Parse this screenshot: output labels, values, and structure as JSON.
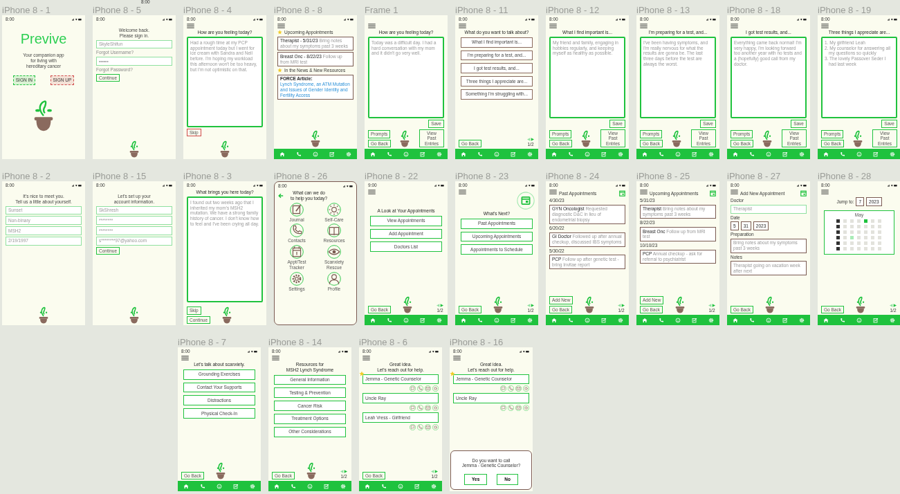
{
  "canvas_label": "8:00",
  "rows": [
    {
      "frames": [
        {
          "title": "iPhone 8 - 1",
          "time": "8:00",
          "menu": false,
          "nav": false,
          "bordered": false,
          "blocks": [
            {
              "kind": "logo",
              "text": "Previve"
            },
            {
              "kind": "para",
              "lines": [
                "Your companion app",
                "for living with",
                "hereditary cancer"
              ]
            },
            {
              "kind": "pair",
              "buttons": [
                {
                  "label": "SIGN IN",
                  "color": "#1fc23e"
                },
                {
                  "label": "SIGN UP",
                  "color": "#d04a4a"
                }
              ]
            },
            {
              "kind": "hero-plant"
            }
          ]
        },
        {
          "title": "iPhone 8 - 5",
          "time": "8:00",
          "menu": false,
          "nav": false,
          "bordered": false,
          "blocks": [
            {
              "kind": "para",
              "lines": [
                "Welcome back.",
                "Please sign in."
              ]
            },
            {
              "kind": "field",
              "value": "SkyleShifun"
            },
            {
              "kind": "link",
              "text": "Forgot Username?"
            },
            {
              "kind": "field",
              "value": "••••••"
            },
            {
              "kind": "link",
              "text": "Forgot Password?"
            },
            {
              "kind": "button",
              "label": "Continue",
              "color": "#1fc23e"
            },
            {
              "kind": "bottom",
              "plant": true
            }
          ]
        },
        {
          "title": "iPhone 8 - 4",
          "time": "8:00",
          "menu": true,
          "nav": false,
          "bordered": false,
          "blocks": [
            {
              "kind": "heading",
              "lines": [
                "How are you feeling today?"
              ]
            },
            {
              "kind": "entry",
              "text": "Had a rough time at my PCP appointment today but I went for ice cream with Sandra and Neil before. I'm hoping my workload this afternoon won't be too heavy, but I'm not optimistic on that."
            },
            {
              "kind": "button",
              "label": "Skip",
              "color": "#d04a4a"
            },
            {
              "kind": "bottom",
              "plant": true
            }
          ]
        },
        {
          "title": "iPhone 8 - 8",
          "time": "8:00",
          "menu": true,
          "nav": true,
          "bordered": false,
          "blocks": [
            {
              "kind": "section",
              "text": "Upcoming Appointments"
            },
            {
              "kind": "card",
              "title": "Therapist - 5/31/23",
              "note": "Bring notes about my symptoms past 3 weeks"
            },
            {
              "kind": "card",
              "title": "Breast Onc - 8/22/23",
              "note": "Follow up from MRI test"
            },
            {
              "kind": "section",
              "text": "In the News & New Resources"
            },
            {
              "kind": "article",
              "label": "FORCE Article:",
              "link": "Lynch Syndrome, an ATM Mutation and Issues of Gender Identity and Fertility Access"
            },
            {
              "kind": "bottom",
              "plant": true
            }
          ]
        },
        {
          "title": "Frame 1",
          "menu": true,
          "nav": true,
          "bordered": false,
          "blocks": [
            {
              "kind": "heading",
              "lines": [
                "How are you feeling today?"
              ]
            },
            {
              "kind": "entry",
              "text": "Today was a difficult day. I had a hard conversation with my mom and it didn't go very well."
            },
            {
              "kind": "bottom",
              "left": [
                "Prompts",
                "Go Back"
              ],
              "right": [
                "Save",
                "View Past Entries"
              ],
              "plant": true
            }
          ]
        },
        {
          "title": "iPhone 8 - 11",
          "time": "8:00",
          "menu": true,
          "nav": true,
          "bordered": false,
          "blocks": [
            {
              "kind": "heading",
              "lines": [
                "What do you want to talk about?"
              ]
            },
            {
              "kind": "option",
              "label": "What I find important is...",
              "color": "#8a6a5e"
            },
            {
              "kind": "option",
              "label": "I'm preparing for a test, and...",
              "color": "#8a6a5e"
            },
            {
              "kind": "option",
              "label": "I got test results, and...",
              "color": "#8a6a5e"
            },
            {
              "kind": "option",
              "label": "Three things I appreciate are...",
              "color": "#8a6a5e"
            },
            {
              "kind": "option",
              "label": "Something I'm struggling with...",
              "color": "#8a6a5e"
            },
            {
              "kind": "bottom",
              "left": [
                "Go Back"
              ],
              "pager": "1/2",
              "plant": false
            }
          ]
        },
        {
          "title": "iPhone 8 - 12",
          "time": "8:00",
          "menu": true,
          "nav": true,
          "bordered": false,
          "blocks": [
            {
              "kind": "heading",
              "lines": [
                "What I find important is..."
              ]
            },
            {
              "kind": "entry",
              "text": "My friend and family, engaging in hobbies regularly, and keeping myself as healthy as possible."
            },
            {
              "kind": "bottom",
              "left": [
                "Prompts",
                "Go Back"
              ],
              "right": [
                "Save",
                "View Past Entries"
              ],
              "plant": true
            }
          ]
        },
        {
          "title": "iPhone 8 - 13",
          "time": "8:00",
          "menu": true,
          "nav": true,
          "bordered": false,
          "blocks": [
            {
              "kind": "heading",
              "lines": [
                "I'm preparing for a test, and..."
              ]
            },
            {
              "kind": "entry",
              "text": "I've been having symptoms, and I'm really nervous for what the results are gonna be. The last three days before the test are always the worst."
            },
            {
              "kind": "bottom",
              "left": [
                "Prompts",
                "Go Back"
              ],
              "right": [
                "Save",
                "View Past Entries"
              ],
              "plant": true
            }
          ]
        },
        {
          "title": "iPhone 8 - 18",
          "time": "8:00",
          "menu": true,
          "nav": true,
          "bordered": false,
          "blocks": [
            {
              "kind": "heading",
              "lines": [
                "I got test results, and..."
              ]
            },
            {
              "kind": "entry",
              "text": "Everything came back normal! I'm very happy, I'm looking forward too another year with no tests and a (hopefully) good call from my doctor."
            },
            {
              "kind": "bottom",
              "left": [
                "Prompts",
                "Go Back"
              ],
              "right": [
                "Save",
                "View Past Entries"
              ],
              "plant": true
            }
          ]
        },
        {
          "title": "iPhone 8 - 19",
          "time": "8:00",
          "menu": true,
          "nav": true,
          "bordered": false,
          "blocks": [
            {
              "kind": "heading",
              "lines": [
                "Three things I appreciate are..."
              ]
            },
            {
              "kind": "entry",
              "items": [
                "1. My girlfriend Leah",
                "2. My counselor for answering all my questions so quickly",
                "3. The lovely Passover Seder I had last week"
              ]
            },
            {
              "kind": "bottom",
              "left": [
                "Prompts",
                "Go Back"
              ],
              "right": [
                "Save",
                "View Past Entries"
              ],
              "plant": true
            }
          ]
        }
      ]
    },
    {
      "frames": [
        {
          "title": "iPhone 8 - 2",
          "time": "8:00",
          "menu": false,
          "nav": false,
          "bordered": false,
          "blocks": [
            {
              "kind": "para",
              "lines": [
                "It's nice to meet you.",
                "Tell us a little about yourself."
              ]
            },
            {
              "kind": "field",
              "value": "Sunset"
            },
            {
              "kind": "field",
              "value": "Non-binary"
            },
            {
              "kind": "field",
              "value": "MSH2"
            },
            {
              "kind": "field",
              "value": "2/19/1997"
            },
            {
              "kind": "bottom",
              "plant": true
            }
          ]
        },
        {
          "title": "iPhone 8 - 15",
          "time": "8:00",
          "menu": false,
          "nav": false,
          "bordered": false,
          "blocks": [
            {
              "kind": "para",
              "lines": [
                "Let's set up your",
                "account information."
              ]
            },
            {
              "kind": "field",
              "value": "SkShresh"
            },
            {
              "kind": "field",
              "value": "********"
            },
            {
              "kind": "field",
              "value": "********"
            },
            {
              "kind": "field",
              "value": "s********97@yahoo.com"
            },
            {
              "kind": "button",
              "label": "Continue",
              "color": "#1fc23e"
            },
            {
              "kind": "bottom",
              "plant": true
            }
          ]
        },
        {
          "title": "iPhone 8 - 3",
          "time": "8:00",
          "menu": false,
          "nav": false,
          "bordered": false,
          "blocks": [
            {
              "kind": "heading",
              "lines": [
                "What brings you here today?"
              ]
            },
            {
              "kind": "entry",
              "text": "I found out two weeks ago that I inherited my mom's MSH2 mutation. We have a strong family history of cancer. I don't know how to feel and I've been crying all day."
            },
            {
              "kind": "bottom",
              "left": [
                "Skip",
                "Continue"
              ],
              "plant": true
            }
          ]
        },
        {
          "title": "iPhone 8 - 26",
          "time": "8:00",
          "menu": false,
          "nav": false,
          "bordered": true,
          "blocks": [
            {
              "kind": "back-heading",
              "lines": [
                "What can we do",
                "to help you today?"
              ]
            },
            {
              "kind": "icon-grid",
              "items": [
                "Journal",
                "Self-Care",
                "Contacts",
                "Resources",
                "Appt/Test Tracker",
                "Scanxiety Rescue",
                "Settings",
                "Profile"
              ]
            }
          ]
        },
        {
          "title": "iPhone 8 - 22",
          "time": "9:00",
          "menu": true,
          "nav": true,
          "bordered": false,
          "blocks": [
            {
              "kind": "spacer"
            },
            {
              "kind": "heading",
              "lines": [
                "A Look at Your Appointments"
              ]
            },
            {
              "kind": "option",
              "label": "View Appointments",
              "color": "#1fc23e"
            },
            {
              "kind": "option",
              "label": "Add Appointment",
              "color": "#1fc23e"
            },
            {
              "kind": "option",
              "label": "Doctors List",
              "color": "#1fc23e"
            },
            {
              "kind": "bottom",
              "left": [
                "Go Back"
              ],
              "pager": "1/2",
              "plant": true
            }
          ]
        },
        {
          "title": "iPhone 8 - 23",
          "time": "8:00",
          "menu": true,
          "nav": true,
          "bordered": false,
          "blocks": [
            {
              "kind": "cal-badge"
            },
            {
              "kind": "heading",
              "lines": [
                "What's Next?"
              ]
            },
            {
              "kind": "option",
              "label": "Past Appointments",
              "color": "#1fc23e"
            },
            {
              "kind": "option",
              "label": "Upcoming Appointments",
              "color": "#1fc23e"
            },
            {
              "kind": "option",
              "label": "Appointments to Schedule",
              "color": "#1fc23e"
            },
            {
              "kind": "bottom",
              "left": [
                "Go Back"
              ],
              "pager": "1/2",
              "plant": true
            }
          ]
        },
        {
          "title": "iPhone 8 - 24",
          "time": "8:00",
          "menu": true,
          "nav": true,
          "bordered": false,
          "blocks": [
            {
              "kind": "title-bar",
              "text": "Past Appointments"
            },
            {
              "kind": "label",
              "text": "4/30/23"
            },
            {
              "kind": "card",
              "title": "GYN Oncologist",
              "note": "Requested diagnostic D&C in lieu of endometrial biopsy"
            },
            {
              "kind": "label",
              "text": "6/20/22"
            },
            {
              "kind": "card",
              "title": "GI Doctor",
              "note": "Followed up after annual checkup, discussed IBS symptoms"
            },
            {
              "kind": "label",
              "text": "5/30/22"
            },
            {
              "kind": "card",
              "title": "PCP",
              "note": "Follow up after genetic test - bring Invitae report"
            },
            {
              "kind": "bottom",
              "left": [
                "Add New",
                "Go Back"
              ],
              "pager": "1/2",
              "plant": true
            }
          ]
        },
        {
          "title": "iPhone 8 - 25",
          "time": "8:00",
          "menu": true,
          "nav": true,
          "bordered": false,
          "blocks": [
            {
              "kind": "title-bar",
              "text": "Upcoming Appointments"
            },
            {
              "kind": "label",
              "text": "5/31/23"
            },
            {
              "kind": "card",
              "title": "Therapist",
              "note": "Bring notes about my symptoms past 3 weeks"
            },
            {
              "kind": "label",
              "text": "8/22/23"
            },
            {
              "kind": "card",
              "title": "Breast Onc",
              "note": "Follow up from MRI test"
            },
            {
              "kind": "label",
              "text": "10/10/23"
            },
            {
              "kind": "card",
              "title": "PCP",
              "note": "Annual checkup - ask for referral to psychiatrist"
            },
            {
              "kind": "bottom",
              "left": [
                "Add New",
                "Go Back"
              ],
              "pager": "1/2",
              "plant": true
            }
          ]
        },
        {
          "title": "iPhone 8 - 27",
          "time": "8:00",
          "menu": true,
          "nav": true,
          "bordered": false,
          "blocks": [
            {
              "kind": "title-bar",
              "text": "Add New Appointment"
            },
            {
              "kind": "label",
              "text": "Doctor"
            },
            {
              "kind": "field",
              "value": "Therapist"
            },
            {
              "kind": "label",
              "text": "Date"
            },
            {
              "kind": "fields",
              "values": [
                "5",
                "31",
                "2023"
              ]
            },
            {
              "kind": "label",
              "text": "Preparation"
            },
            {
              "kind": "note-field",
              "value": "Bring notes about my symptoms past 3 weeks"
            },
            {
              "kind": "label",
              "text": "Notes"
            },
            {
              "kind": "note-field",
              "value": "Therapist going on vacation week after next"
            },
            {
              "kind": "bottom",
              "left": [
                "Go Back"
              ],
              "plant": true
            }
          ]
        },
        {
          "title": "iPhone 8 - 28",
          "time": "8:00",
          "menu": true,
          "nav": true,
          "bordered": false,
          "blocks": [
            {
              "kind": "jump",
              "label": "Jump to:",
              "values": [
                "7",
                "2023"
              ]
            },
            {
              "kind": "calendar",
              "month": "May"
            },
            {
              "kind": "bottom",
              "left": [
                "Go Back"
              ],
              "pager": "1/2",
              "plant": true
            }
          ]
        }
      ]
    },
    {
      "frames": [
        {
          "title": "iPhone 8 - 7",
          "time": "8:00",
          "menu": true,
          "nav": true,
          "bordered": false,
          "blocks": [
            {
              "kind": "heading",
              "lines": [
                "Let's talk about scanxiety."
              ]
            },
            {
              "kind": "option",
              "label": "Grounding Exercises",
              "color": "#1fc23e"
            },
            {
              "kind": "option",
              "label": "Contact Your Supports",
              "color": "#1fc23e"
            },
            {
              "kind": "option",
              "label": "Distractions",
              "color": "#1fc23e"
            },
            {
              "kind": "option",
              "label": "Physical Check-In",
              "color": "#1fc23e"
            },
            {
              "kind": "bottom",
              "left": [
                "Go Back"
              ],
              "plant": true
            }
          ]
        },
        {
          "title": "iPhone 8 - 14",
          "time": "8:00",
          "menu": true,
          "nav": true,
          "bordered": false,
          "blocks": [
            {
              "kind": "heading",
              "lines": [
                "Resources for",
                "MSH2 Lynch Syndrome"
              ]
            },
            {
              "kind": "option",
              "label": "General Information",
              "color": "#1fc23e"
            },
            {
              "kind": "option",
              "label": "Testing & Prevention",
              "color": "#1fc23e"
            },
            {
              "kind": "option",
              "label": "Cancer Risk",
              "color": "#1fc23e"
            },
            {
              "kind": "option",
              "label": "Treatment Options",
              "color": "#1fc23e"
            },
            {
              "kind": "option",
              "label": "Other Considerations",
              "color": "#1fc23e"
            },
            {
              "kind": "bottom",
              "left": [
                "Go Back"
              ],
              "pager": "1/2",
              "plant": true
            }
          ]
        },
        {
          "title": "iPhone 8 - 6",
          "time": "8:00",
          "menu": true,
          "nav": true,
          "bordered": false,
          "blocks": [
            {
              "kind": "heading",
              "lines": [
                "Great idea.",
                "Let's reach out for help."
              ]
            },
            {
              "kind": "contact",
              "name": "Jemma - Genetic Counselor",
              "starred": true
            },
            {
              "kind": "contact",
              "name": "Uncle Ray",
              "starred": false
            },
            {
              "kind": "contact",
              "name": "Leah Vress - Girlfriend",
              "starred": false
            },
            {
              "kind": "bottom",
              "left": [
                "Go Back"
              ],
              "pager": "1/2",
              "plant": false
            }
          ]
        },
        {
          "title": "iPhone 8 - 16",
          "time": "8:00",
          "menu": true,
          "nav": false,
          "bordered": false,
          "blocks": [
            {
              "kind": "heading",
              "lines": [
                "Great idea.",
                "Let's reach out for help."
              ]
            },
            {
              "kind": "contact",
              "name": "Jemma - Genetic Counselor",
              "starred": true
            },
            {
              "kind": "contact",
              "name": "Uncle Ray",
              "starred": false
            },
            {
              "kind": "dialog",
              "lines": [
                "Do you want to call",
                "Jemma - Genetic Counselor?"
              ],
              "buttons": [
                "Yes",
                "No"
              ]
            }
          ]
        }
      ]
    }
  ]
}
